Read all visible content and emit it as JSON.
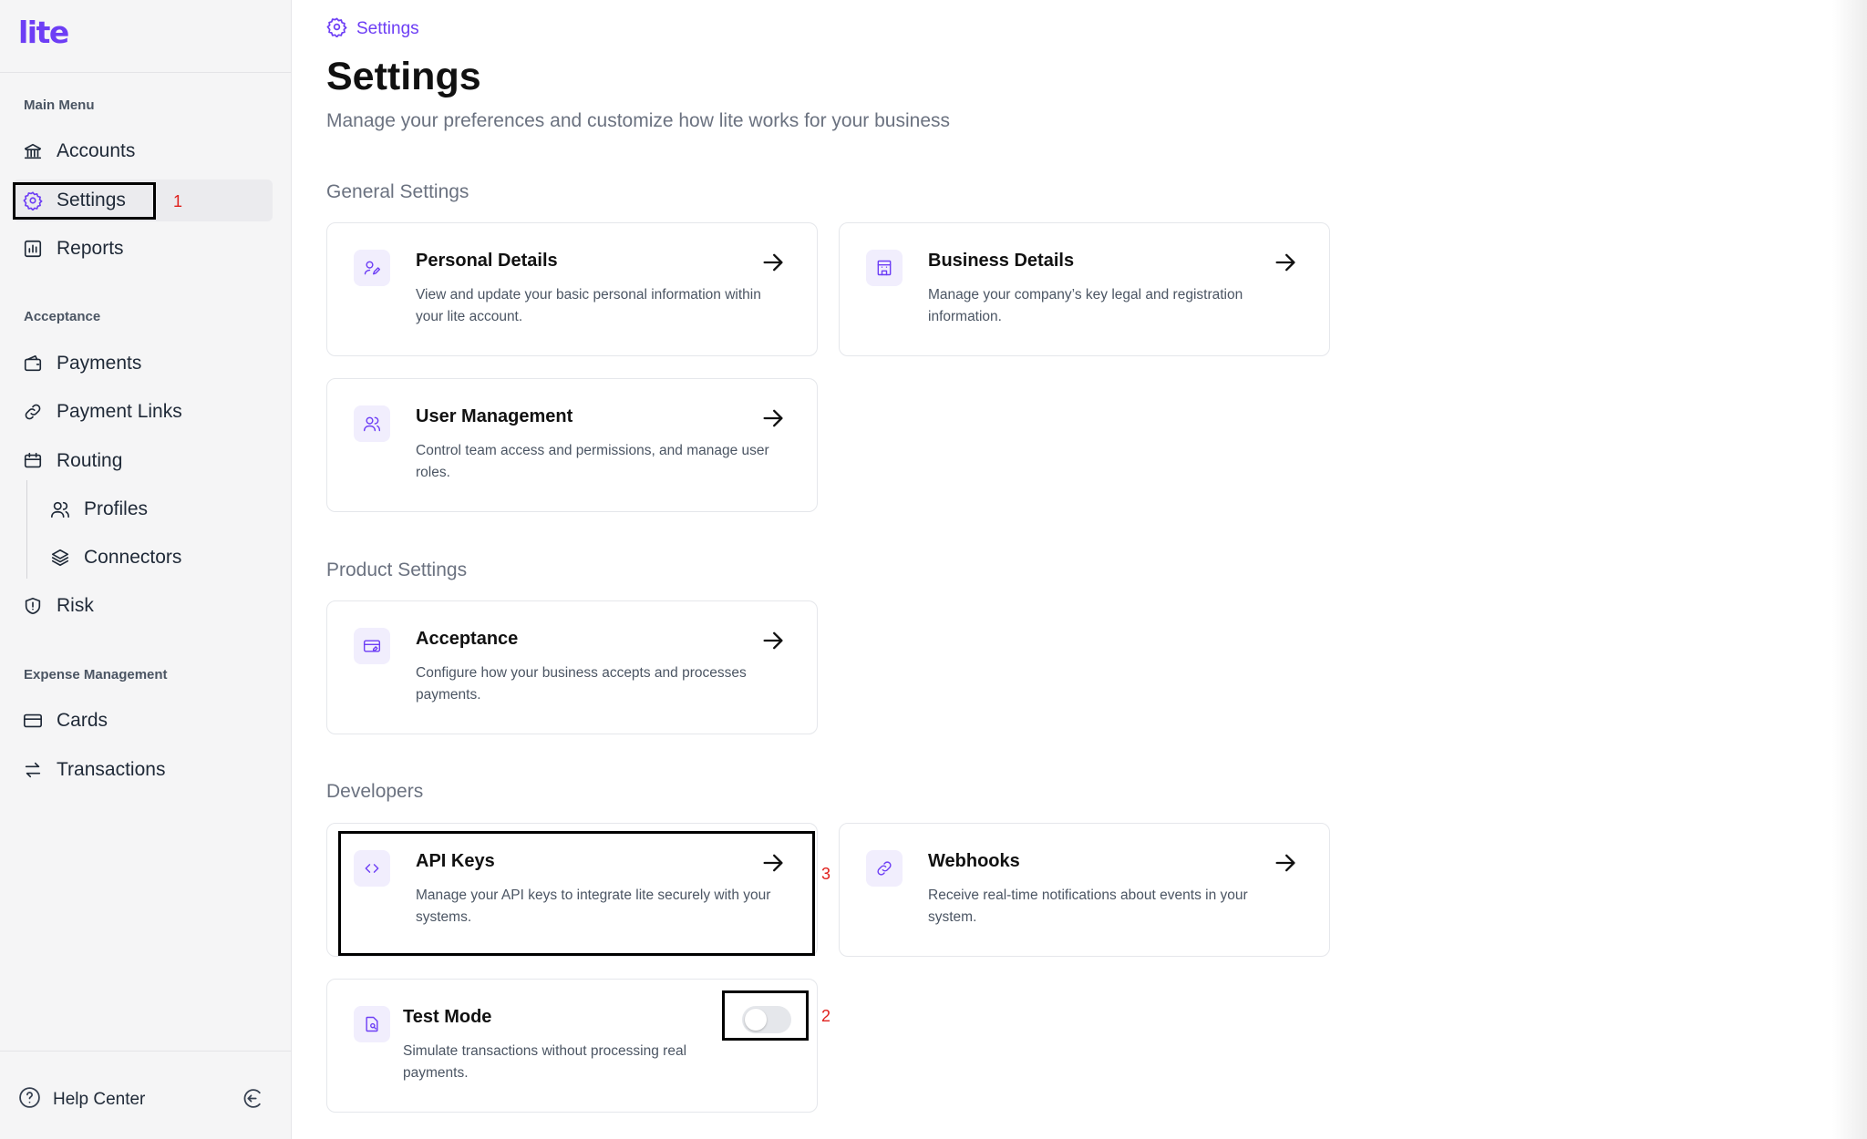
{
  "app": {
    "logo": "lite"
  },
  "sidebar": {
    "sections": [
      {
        "label": "Main Menu"
      },
      {
        "label": "Acceptance"
      },
      {
        "label": "Expense Management"
      }
    ],
    "items": [
      {
        "label": "Accounts",
        "icon": "bank-icon"
      },
      {
        "label": "Settings",
        "icon": "gear-icon",
        "active": true
      },
      {
        "label": "Reports",
        "icon": "bar-chart-icon"
      },
      {
        "label": "Payments",
        "icon": "wallet-icon"
      },
      {
        "label": "Payment Links",
        "icon": "link-icon"
      },
      {
        "label": "Routing",
        "icon": "routing-icon"
      },
      {
        "label": "Profiles",
        "icon": "users-icon"
      },
      {
        "label": "Connectors",
        "icon": "layers-icon"
      },
      {
        "label": "Risk",
        "icon": "shield-icon"
      },
      {
        "label": "Cards",
        "icon": "credit-card-icon"
      },
      {
        "label": "Transactions",
        "icon": "transfer-icon"
      }
    ],
    "help": {
      "label": "Help Center",
      "icon": "help-circle-icon"
    },
    "collapse_icon": "collapse-sidebar-icon"
  },
  "breadcrumb": {
    "label": "Settings",
    "icon": "gear-icon"
  },
  "page": {
    "title": "Settings",
    "subtitle": "Manage your preferences and customize how lite works for your business"
  },
  "groups": [
    {
      "title": "General Settings"
    },
    {
      "title": "Product Settings"
    },
    {
      "title": "Developers"
    }
  ],
  "cards": [
    {
      "title": "Personal Details",
      "desc": "View and update your basic personal information within your lite account.",
      "icon": "user-edit-icon"
    },
    {
      "title": "Business Details",
      "desc": "Manage your company’s key legal and registration information.",
      "icon": "building-icon"
    },
    {
      "title": "User Management",
      "desc": "Control team access and permissions, and manage user roles.",
      "icon": "users-icon"
    },
    {
      "title": "Acceptance",
      "desc": "Configure how your business accepts and processes payments.",
      "icon": "card-settings-icon"
    },
    {
      "title": "API Keys",
      "desc": "Manage your API keys to integrate lite securely with your systems.",
      "icon": "code-icon"
    },
    {
      "title": "Webhooks",
      "desc": "Receive real-time notifications about events in your system.",
      "icon": "link-icon"
    },
    {
      "title": "Test Mode",
      "desc": "Simulate transactions without processing real payments.",
      "icon": "test-doc-icon",
      "toggle_on": false
    }
  ],
  "annotations": [
    "1",
    "2",
    "3"
  ],
  "colors": {
    "accent": "#6d3ef5",
    "annotation": "#e0201c"
  }
}
